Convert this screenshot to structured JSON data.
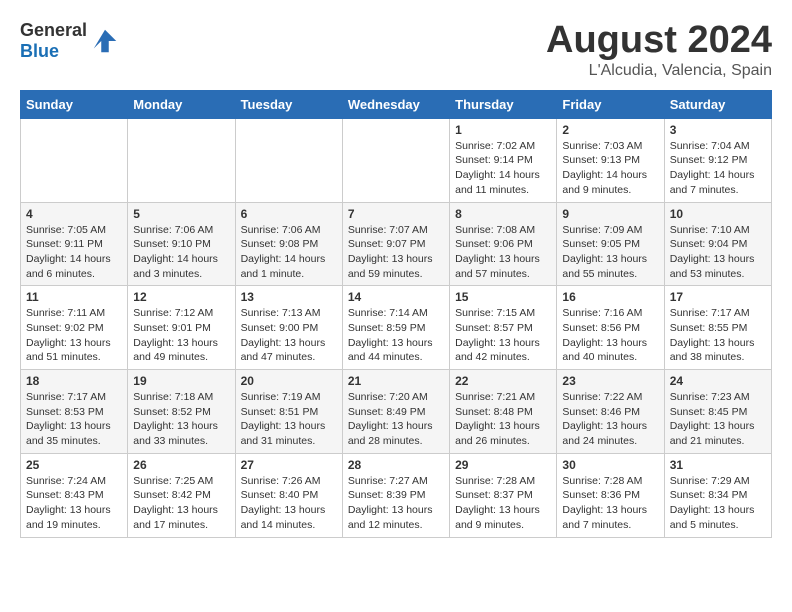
{
  "header": {
    "logo_general": "General",
    "logo_blue": "Blue",
    "month": "August 2024",
    "location": "L'Alcudia, Valencia, Spain"
  },
  "days_of_week": [
    "Sunday",
    "Monday",
    "Tuesday",
    "Wednesday",
    "Thursday",
    "Friday",
    "Saturday"
  ],
  "weeks": [
    [
      {
        "day": "",
        "empty": true
      },
      {
        "day": "",
        "empty": true
      },
      {
        "day": "",
        "empty": true
      },
      {
        "day": "",
        "empty": true
      },
      {
        "day": "1",
        "sunrise": "7:02 AM",
        "sunset": "9:14 PM",
        "daylight": "14 hours and 11 minutes."
      },
      {
        "day": "2",
        "sunrise": "7:03 AM",
        "sunset": "9:13 PM",
        "daylight": "14 hours and 9 minutes."
      },
      {
        "day": "3",
        "sunrise": "7:04 AM",
        "sunset": "9:12 PM",
        "daylight": "14 hours and 7 minutes."
      }
    ],
    [
      {
        "day": "4",
        "sunrise": "7:05 AM",
        "sunset": "9:11 PM",
        "daylight": "14 hours and 6 minutes."
      },
      {
        "day": "5",
        "sunrise": "7:06 AM",
        "sunset": "9:10 PM",
        "daylight": "14 hours and 3 minutes."
      },
      {
        "day": "6",
        "sunrise": "7:06 AM",
        "sunset": "9:08 PM",
        "daylight": "14 hours and 1 minute."
      },
      {
        "day": "7",
        "sunrise": "7:07 AM",
        "sunset": "9:07 PM",
        "daylight": "13 hours and 59 minutes."
      },
      {
        "day": "8",
        "sunrise": "7:08 AM",
        "sunset": "9:06 PM",
        "daylight": "13 hours and 57 minutes."
      },
      {
        "day": "9",
        "sunrise": "7:09 AM",
        "sunset": "9:05 PM",
        "daylight": "13 hours and 55 minutes."
      },
      {
        "day": "10",
        "sunrise": "7:10 AM",
        "sunset": "9:04 PM",
        "daylight": "13 hours and 53 minutes."
      }
    ],
    [
      {
        "day": "11",
        "sunrise": "7:11 AM",
        "sunset": "9:02 PM",
        "daylight": "13 hours and 51 minutes."
      },
      {
        "day": "12",
        "sunrise": "7:12 AM",
        "sunset": "9:01 PM",
        "daylight": "13 hours and 49 minutes."
      },
      {
        "day": "13",
        "sunrise": "7:13 AM",
        "sunset": "9:00 PM",
        "daylight": "13 hours and 47 minutes."
      },
      {
        "day": "14",
        "sunrise": "7:14 AM",
        "sunset": "8:59 PM",
        "daylight": "13 hours and 44 minutes."
      },
      {
        "day": "15",
        "sunrise": "7:15 AM",
        "sunset": "8:57 PM",
        "daylight": "13 hours and 42 minutes."
      },
      {
        "day": "16",
        "sunrise": "7:16 AM",
        "sunset": "8:56 PM",
        "daylight": "13 hours and 40 minutes."
      },
      {
        "day": "17",
        "sunrise": "7:17 AM",
        "sunset": "8:55 PM",
        "daylight": "13 hours and 38 minutes."
      }
    ],
    [
      {
        "day": "18",
        "sunrise": "7:17 AM",
        "sunset": "8:53 PM",
        "daylight": "13 hours and 35 minutes."
      },
      {
        "day": "19",
        "sunrise": "7:18 AM",
        "sunset": "8:52 PM",
        "daylight": "13 hours and 33 minutes."
      },
      {
        "day": "20",
        "sunrise": "7:19 AM",
        "sunset": "8:51 PM",
        "daylight": "13 hours and 31 minutes."
      },
      {
        "day": "21",
        "sunrise": "7:20 AM",
        "sunset": "8:49 PM",
        "daylight": "13 hours and 28 minutes."
      },
      {
        "day": "22",
        "sunrise": "7:21 AM",
        "sunset": "8:48 PM",
        "daylight": "13 hours and 26 minutes."
      },
      {
        "day": "23",
        "sunrise": "7:22 AM",
        "sunset": "8:46 PM",
        "daylight": "13 hours and 24 minutes."
      },
      {
        "day": "24",
        "sunrise": "7:23 AM",
        "sunset": "8:45 PM",
        "daylight": "13 hours and 21 minutes."
      }
    ],
    [
      {
        "day": "25",
        "sunrise": "7:24 AM",
        "sunset": "8:43 PM",
        "daylight": "13 hours and 19 minutes."
      },
      {
        "day": "26",
        "sunrise": "7:25 AM",
        "sunset": "8:42 PM",
        "daylight": "13 hours and 17 minutes."
      },
      {
        "day": "27",
        "sunrise": "7:26 AM",
        "sunset": "8:40 PM",
        "daylight": "13 hours and 14 minutes."
      },
      {
        "day": "28",
        "sunrise": "7:27 AM",
        "sunset": "8:39 PM",
        "daylight": "13 hours and 12 minutes."
      },
      {
        "day": "29",
        "sunrise": "7:28 AM",
        "sunset": "8:37 PM",
        "daylight": "13 hours and 9 minutes."
      },
      {
        "day": "30",
        "sunrise": "7:28 AM",
        "sunset": "8:36 PM",
        "daylight": "13 hours and 7 minutes."
      },
      {
        "day": "31",
        "sunrise": "7:29 AM",
        "sunset": "8:34 PM",
        "daylight": "13 hours and 5 minutes."
      }
    ]
  ],
  "labels": {
    "sunrise": "Sunrise:",
    "sunset": "Sunset:",
    "daylight": "Daylight hours"
  }
}
